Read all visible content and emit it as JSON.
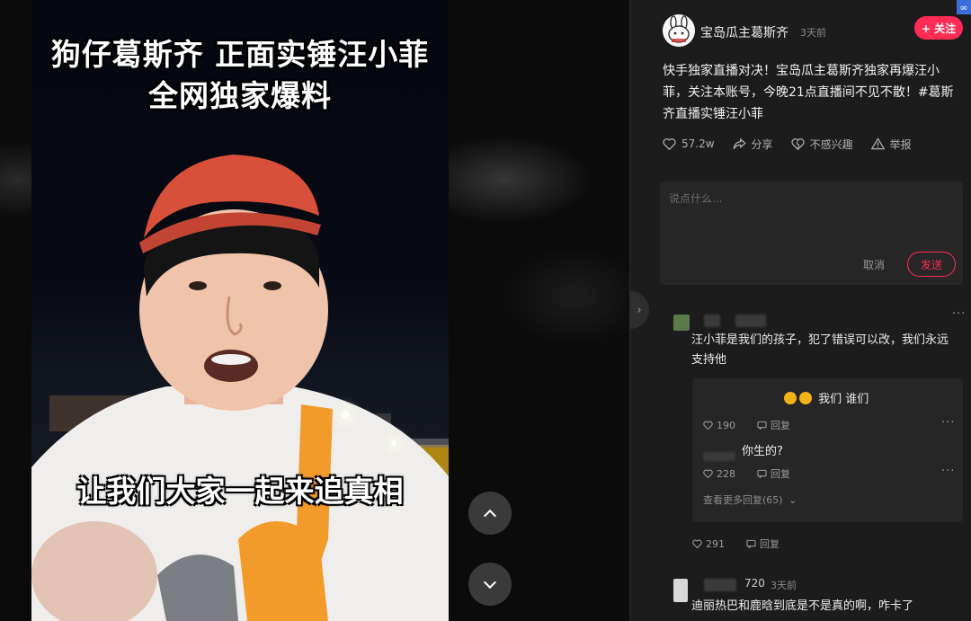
{
  "video": {
    "title_line1": "狗仔葛斯齐 正面实锤汪小菲",
    "title_line2": "全网独家爆料",
    "caption": "让我们大家一起来追真相"
  },
  "post": {
    "author": "宝岛瓜主葛斯齐",
    "time": "3天前",
    "follow_label": "+ 关注",
    "text": "快手独家直播对决！宝岛瓜主葛斯齐独家再爆汪小菲，关注本账号，今晚21点直播间不见不散！#葛斯齐直播实锤汪小菲",
    "actions": {
      "likes": "57.2w",
      "share": "分享",
      "not_interested": "不感兴趣",
      "report": "举报"
    }
  },
  "comment_box": {
    "placeholder": "说点什么...",
    "cancel": "取消",
    "send": "发送"
  },
  "comments": [
    {
      "text": "汪小菲是我们的孩子，犯了错误可以改，我们永远支持他",
      "likes": "291",
      "reply_label": "回复",
      "replies": [
        {
          "text": "我们  谁们",
          "likes": "190",
          "reply_label": "回复"
        },
        {
          "text": "你生的?",
          "likes": "228",
          "reply_label": "回复"
        }
      ],
      "more_replies": "查看更多回复(65)"
    },
    {
      "name_fragment": "720",
      "time": "3天前",
      "text": "迪丽热巴和鹿晗到底是不是真的啊，咋卡了"
    }
  ],
  "colors": {
    "accent": "#fe2c55",
    "panel_bg": "#1c1c1c"
  },
  "icons": {
    "like": "heart-icon",
    "share": "share-icon",
    "not_interested": "broken-heart-icon",
    "report": "warning-icon",
    "more": "more-dots-icon",
    "nav_up": "chevron-up-icon",
    "nav_down": "chevron-down-icon"
  }
}
